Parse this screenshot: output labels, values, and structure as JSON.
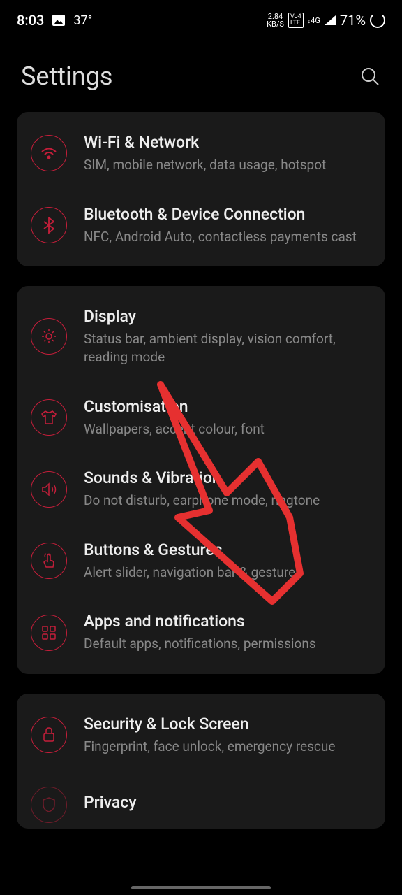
{
  "statusbar": {
    "time": "8:03",
    "temp": "37°",
    "net_speed_top": "2.84",
    "net_speed_bottom": "KB/S",
    "lte": "Vo4\nLTE",
    "signal_4g": "4G",
    "battery": "71%"
  },
  "header": {
    "title": "Settings"
  },
  "cards": [
    {
      "items": [
        {
          "title": "Wi-Fi & Network",
          "subtitle": "SIM, mobile network, data usage, hotspot",
          "icon": "wifi"
        },
        {
          "title": "Bluetooth & Device Connection",
          "subtitle": "NFC, Android Auto, contactless payments cast",
          "icon": "bluetooth"
        }
      ]
    },
    {
      "items": [
        {
          "title": "Display",
          "subtitle": "Status bar, ambient display, vision comfort, reading mode",
          "icon": "brightness"
        },
        {
          "title": "Customisation",
          "subtitle": "Wallpapers, accent colour, font",
          "icon": "shirt"
        },
        {
          "title": "Sounds & Vibration",
          "subtitle": "Do not disturb, earphone mode, ringtone",
          "icon": "speaker"
        },
        {
          "title": "Buttons & Gestures",
          "subtitle": "Alert slider, navigation bar & gestures",
          "icon": "touch"
        },
        {
          "title": "Apps and notifications",
          "subtitle": "Default apps, notifications, permissions",
          "icon": "apps"
        }
      ]
    },
    {
      "items": [
        {
          "title": "Security & Lock Screen",
          "subtitle": "Fingerprint, face unlock, emergency rescue",
          "icon": "lock"
        },
        {
          "title": "Privacy",
          "subtitle": "",
          "icon": "shield"
        }
      ]
    }
  ]
}
